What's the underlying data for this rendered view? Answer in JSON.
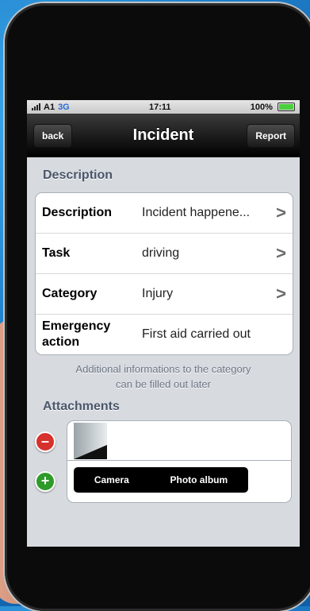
{
  "status": {
    "carrier": "A1",
    "network": "3G",
    "time": "17:11",
    "battery": "100%"
  },
  "nav": {
    "back_label": "back",
    "title": "Incident",
    "report_label": "Report"
  },
  "description_section": {
    "header": "Description",
    "rows": [
      {
        "label": "Description",
        "value": "Incident happene...",
        "chevron": ">"
      },
      {
        "label": "Task",
        "value": "driving",
        "chevron": ">"
      },
      {
        "label": "Category",
        "value": "Injury",
        "chevron": ">"
      },
      {
        "label": "Emergency action",
        "value": "First aid carried out",
        "chevron": ""
      }
    ],
    "footer_line1": "Additional informations to the category",
    "footer_line2": "can be filled out later"
  },
  "attachments": {
    "header": "Attachments",
    "delete_icon": "minus",
    "add_icon": "+",
    "camera_label": "Camera",
    "photo_album_label": "Photo album"
  }
}
